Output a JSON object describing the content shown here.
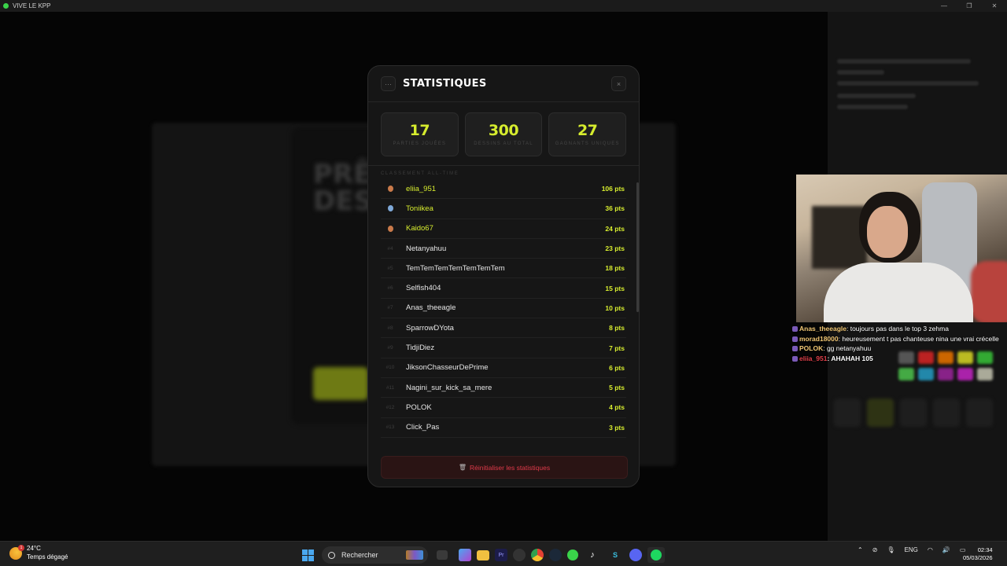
{
  "window": {
    "title": "VIVE LE KPP"
  },
  "modal": {
    "back_icon": "more-icon",
    "title": "STATISTIQUES",
    "close_symbol": "×",
    "stats": [
      {
        "value": "17",
        "label": "PARTIES JOUÉES"
      },
      {
        "value": "300",
        "label": "DESSINS AU TOTAL"
      },
      {
        "value": "27",
        "label": "GAGNANTS UNIQUES"
      }
    ],
    "section_label": "CLASSEMENT ALL-TIME",
    "leaderboard": [
      {
        "rank": "1",
        "name": "eliia_951",
        "points": "106 pts",
        "medal": "bronze"
      },
      {
        "rank": "2",
        "name": "Toniikea",
        "points": "36 pts",
        "medal": "silver"
      },
      {
        "rank": "3",
        "name": "Kaido67",
        "points": "24 pts",
        "medal": "bronze"
      },
      {
        "rank": "#4",
        "name": "Netanyahuu",
        "points": "23 pts"
      },
      {
        "rank": "#5",
        "name": "TemTemTemTemTemTemTem",
        "points": "18 pts"
      },
      {
        "rank": "#6",
        "name": "Selfish404",
        "points": "15 pts"
      },
      {
        "rank": "#7",
        "name": "Anas_theeagle",
        "points": "10 pts"
      },
      {
        "rank": "#8",
        "name": "SparrowDYota",
        "points": "8 pts"
      },
      {
        "rank": "#9",
        "name": "TidjiDiez",
        "points": "7 pts"
      },
      {
        "rank": "#10",
        "name": "JiksonChasseurDePrime",
        "points": "6 pts"
      },
      {
        "rank": "#11",
        "name": "Nagini_sur_kick_sa_mere",
        "points": "5 pts"
      },
      {
        "rank": "#12",
        "name": "POLOK",
        "points": "4 pts"
      },
      {
        "rank": "#13",
        "name": "Click_Pas",
        "points": "3 pts"
      }
    ],
    "reset_label": "Réinitialiser les statistiques",
    "reset_icon": "trash-icon"
  },
  "chat": [
    {
      "user": "Anas_theeagle",
      "text": ": toujours pas dans le top 3 zehma",
      "color": "#f0c674"
    },
    {
      "user": "morad18000",
      "text": ": heureusement t pas chanteuse nina une vrai crécelle",
      "color": "#f0c674"
    },
    {
      "user": "POLOK",
      "text": ": gg netanyahuu",
      "color": "#f0c674"
    },
    {
      "user": "eliia_951",
      "text": ": AHAHAH 105",
      "color": "#e0404a"
    }
  ],
  "taskbar": {
    "weather_temp": "24°C",
    "weather_desc": "Temps dégagé",
    "search_placeholder": "Rechercher",
    "tray_lang": "ENG",
    "clock_time": "02:34",
    "clock_date": "05/03/2026"
  },
  "colors": {
    "accent": "#d8ee2f",
    "danger": "#e03a4a",
    "background": "#050505"
  }
}
